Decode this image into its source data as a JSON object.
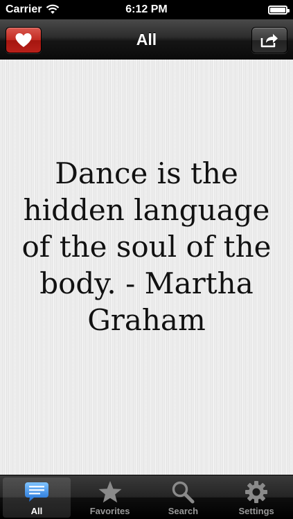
{
  "status_bar": {
    "carrier": "Carrier",
    "time": "6:12 PM"
  },
  "nav": {
    "title": "All",
    "left_button_icon": "heart-icon",
    "right_button_icon": "share-icon"
  },
  "quote": {
    "text": "Dance is the hidden language of the soul of the body. - Martha Graham"
  },
  "tabs": [
    {
      "label": "All",
      "icon": "speech-bubble-icon",
      "active": true
    },
    {
      "label": "Favorites",
      "icon": "star-icon",
      "active": false
    },
    {
      "label": "Search",
      "icon": "magnifier-icon",
      "active": false
    },
    {
      "label": "Settings",
      "icon": "gear-icon",
      "active": false
    }
  ],
  "colors": {
    "favorite_button": "#c22a21",
    "active_tab_icon": "#3b8be6",
    "inactive_tab_icon": "#8a8a8a"
  }
}
